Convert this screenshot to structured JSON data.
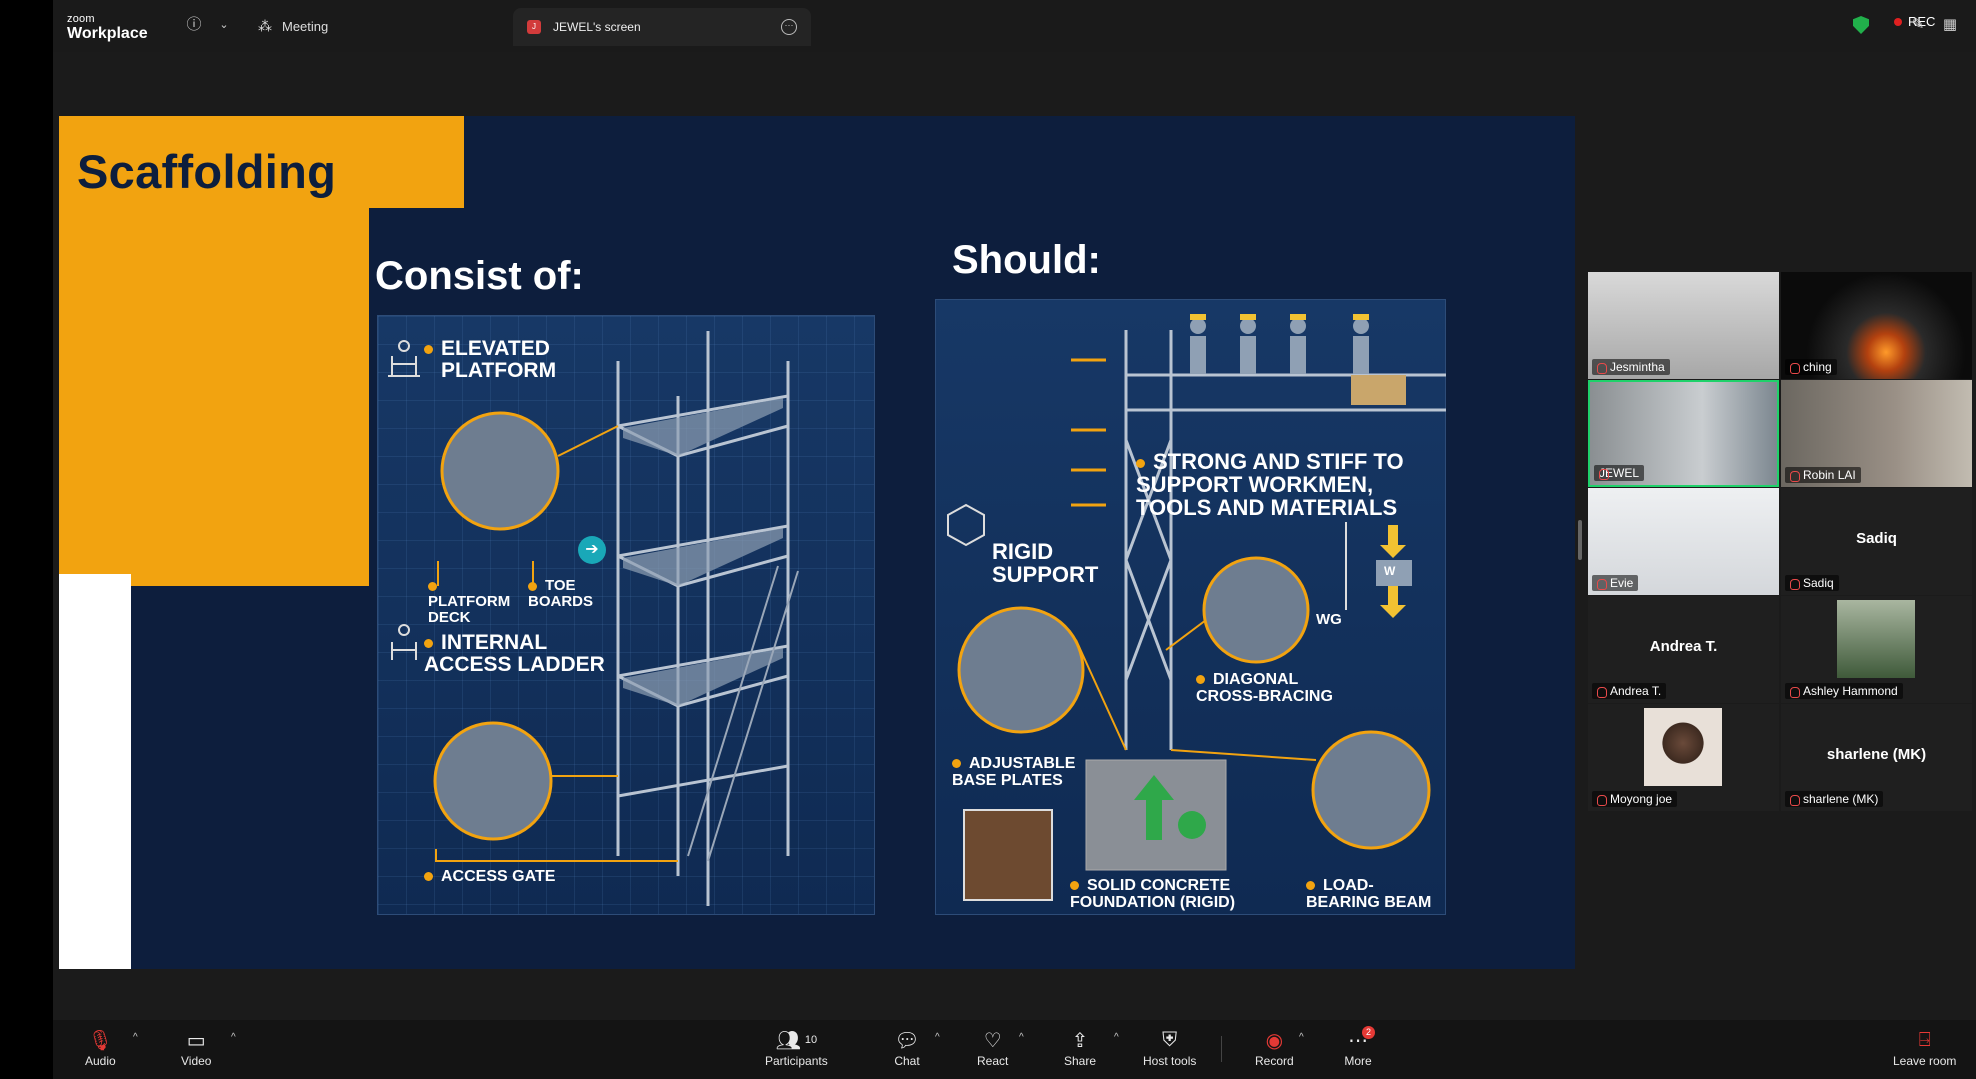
{
  "topbar": {
    "logo_small": "zoom",
    "logo_main": "Workplace",
    "meeting_label": "Meeting",
    "screen_tab_label": "JEWEL's screen",
    "screen_tab_badge": "J",
    "rec_label": "REC"
  },
  "slide": {
    "title": "Scaffolding",
    "left_heading": "Consist of:",
    "right_heading": "Should:",
    "left_labels": {
      "elevated": "ELEVATED PLATFORM",
      "deck": "PLATFORM DECK",
      "toe": "TOE BOARDS",
      "ladder": "INTERNAL ACCESS LADDER",
      "gate": "ACCESS GATE"
    },
    "right_labels": {
      "strong": "STRONG AND STIFF TO SUPPORT WORKMEN, TOOLS AND MATERIALS",
      "rigid": "RIGID SUPPORT",
      "wg": "WG",
      "w": "W",
      "diagonal": "DIAGONAL CROSS-BRACING",
      "baseplates": "ADJUSTABLE BASE PLATES",
      "foundation": "SOLID CONCRETE FOUNDATION (RIGID)",
      "beam": "LOAD-BEARING BEAM"
    }
  },
  "participants": [
    {
      "name": "Jesmintha",
      "center": ""
    },
    {
      "name": "ching",
      "center": ""
    },
    {
      "name": "JEWEL",
      "center": ""
    },
    {
      "name": "Robin LAI",
      "center": ""
    },
    {
      "name": "Evie",
      "center": ""
    },
    {
      "name": "Sadiq",
      "center": "Sadiq"
    },
    {
      "name": "Andrea T.",
      "center": "Andrea T."
    },
    {
      "name": "Ashley Hammond",
      "center": ""
    },
    {
      "name": "Moyong joe",
      "center": ""
    },
    {
      "name": "sharlene (MK)",
      "center": "sharlene (MK)"
    }
  ],
  "toolbar": {
    "audio": "Audio",
    "video": "Video",
    "participants": "Participants",
    "participants_count": "10",
    "chat": "Chat",
    "react": "React",
    "share": "Share",
    "host_tools": "Host tools",
    "record": "Record",
    "more": "More",
    "more_badge": "2",
    "leave": "Leave room"
  },
  "colors": {
    "accent_orange": "#f2a310",
    "slide_navy": "#0d1e3d",
    "active_green": "#1fd16a",
    "record_red": "#e02020"
  }
}
